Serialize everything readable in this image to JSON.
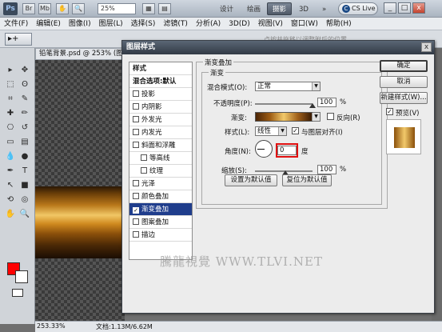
{
  "app": {
    "logo": "Ps",
    "zoom": "25%",
    "workspaces": [
      "设计",
      "绘画",
      "摄影",
      "3D"
    ],
    "active_workspace": "摄影",
    "more": "»",
    "cslive": "CS Live",
    "window_controls": [
      "_",
      "□",
      "x"
    ]
  },
  "menu": [
    "文件(F)",
    "编辑(E)",
    "图像(I)",
    "图层(L)",
    "选择(S)",
    "滤镜(T)",
    "分析(A)",
    "3D(D)",
    "视图(V)",
    "窗口(W)",
    "帮助(H)"
  ],
  "options": {
    "tool": "▸+",
    "hint": "点按并拖移以调整附后的位置"
  },
  "document": {
    "tab": "铅笔背景.psd @ 253% (图",
    "zoom": "253.33%",
    "info": "文档:1.13M/6.62M"
  },
  "dialog": {
    "title": "图层样式",
    "style_list": {
      "header": "样式",
      "blend_default": "混合选项:默认",
      "items": [
        {
          "label": "投影",
          "checked": false,
          "indent": false,
          "selected": false
        },
        {
          "label": "内阴影",
          "checked": false,
          "indent": false,
          "selected": false
        },
        {
          "label": "外发光",
          "checked": false,
          "indent": false,
          "selected": false
        },
        {
          "label": "内发光",
          "checked": false,
          "indent": false,
          "selected": false
        },
        {
          "label": "斜面和浮雕",
          "checked": false,
          "indent": false,
          "selected": false
        },
        {
          "label": "等高线",
          "checked": false,
          "indent": true,
          "selected": false
        },
        {
          "label": "纹理",
          "checked": false,
          "indent": true,
          "selected": false
        },
        {
          "label": "光泽",
          "checked": false,
          "indent": false,
          "selected": false
        },
        {
          "label": "颜色叠加",
          "checked": false,
          "indent": false,
          "selected": false
        },
        {
          "label": "渐变叠加",
          "checked": true,
          "indent": false,
          "selected": true
        },
        {
          "label": "图案叠加",
          "checked": false,
          "indent": false,
          "selected": false
        },
        {
          "label": "描边",
          "checked": false,
          "indent": false,
          "selected": false
        }
      ]
    },
    "section_title": "渐变叠加",
    "group_title": "渐变",
    "blend_mode_label": "混合模式(O):",
    "blend_mode_value": "正常",
    "opacity_label": "不透明度(P):",
    "opacity_value": "100",
    "opacity_unit": "%",
    "gradient_label": "渐变:",
    "reverse_label": "反向(R)",
    "style_label": "样式(L):",
    "style_value": "线性",
    "align_label": "与图层对齐(I)",
    "angle_label": "角度(N):",
    "angle_value": "0",
    "angle_unit": "度",
    "scale_label": "缩放(S):",
    "scale_value": "100",
    "scale_unit": "%",
    "reset_default": "设置为默认值",
    "restore_default": "复位为默认值",
    "ok": "确定",
    "cancel": "取消",
    "new_style": "新建样式(W)...",
    "preview_label": "预览(V)"
  },
  "watermark": "騰龍視覺 WWW.TLVI.NET"
}
